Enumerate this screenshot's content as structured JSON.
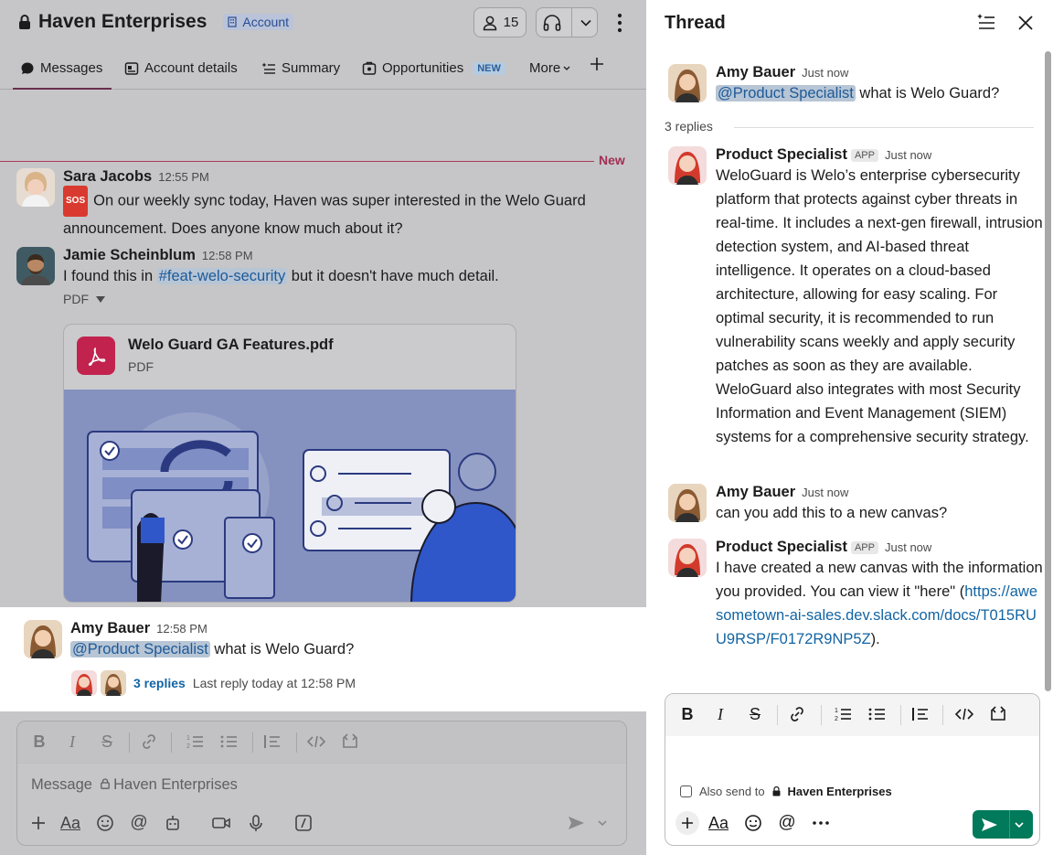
{
  "channel": {
    "name": "Haven Enterprises",
    "account_badge": "Account",
    "member_count": "15"
  },
  "tabs": [
    {
      "label": "Messages",
      "icon": "message-icon",
      "active": true
    },
    {
      "label": "Account details",
      "icon": "account-details-icon"
    },
    {
      "label": "Summary",
      "icon": "summary-icon"
    },
    {
      "label": "Opportunities",
      "icon": "opportunities-icon",
      "badge": "NEW"
    },
    {
      "label": "More",
      "icon": "chevron-down-icon"
    }
  ],
  "new_divider_label": "New",
  "messages": [
    {
      "author": "Sara Jacobs",
      "time": "12:55 PM",
      "emoji": "SOS",
      "text": "On our weekly sync today, Haven was super interested in the Welo Guard announcement. Does anyone know much about it?"
    },
    {
      "author": "Jamie Scheinblum",
      "time": "12:58 PM",
      "text_before": "I found this in ",
      "channel_link": "#feat-welo-security",
      "text_after": " but it doesn't have much detail.",
      "attachment_kind": "PDF",
      "file_name": "Welo Guard GA Features.pdf",
      "file_type": "PDF"
    },
    {
      "author": "Amy Bauer",
      "time": "12:58 PM",
      "mention": "@Product Specialist",
      "text": " what is Welo Guard?",
      "replies": "3 replies",
      "last_reply": "Last reply today at 12:58 PM"
    }
  ],
  "composer_left": {
    "placeholder_prefix": "Message",
    "placeholder_channel": "Haven Enterprises"
  },
  "thread": {
    "title": "Thread",
    "root": {
      "author": "Amy Bauer",
      "time": "Just now",
      "mention": "@Product Specialist",
      "text": " what is Welo Guard?"
    },
    "reply_count": "3 replies",
    "replies": [
      {
        "author": "Product Specialist",
        "tag": "APP",
        "time": "Just now",
        "text": "WeloGuard is Welo’s enterprise cybersecurity platform that protects against cyber threats in real-time. It includes a next-gen firewall, intrusion detection system, and AI-based threat intelligence. It operates on a cloud-based architecture, allowing for easy scaling. For optimal security, it is recommended to run vulnerability scans weekly and apply security patches as soon as they are available. WeloGuard also integrates with most Security Information and Event Management (SIEM) systems for a comprehensive security strategy."
      },
      {
        "author": "Amy Bauer",
        "time": "Just now",
        "text": "can you add this to a new canvas?"
      },
      {
        "author": "Product Specialist",
        "tag": "APP",
        "time": "Just now",
        "text_before": "I have created a new canvas with the information you provided. You can view it \"here\" (",
        "link": "https://awesometown-ai-sales.dev.slack.com/docs/T015RUU9RSP/F0172R9NP5Z",
        "text_after": ")."
      }
    ],
    "composer": {
      "also_send_prefix": "Also send to",
      "also_send_channel": "Haven Enterprises"
    }
  },
  "colors": {
    "send_button": "#007a5a",
    "mention_text": "#1264a3",
    "new_divider": "#b0395c",
    "pdf_icon": "#c2234e"
  }
}
